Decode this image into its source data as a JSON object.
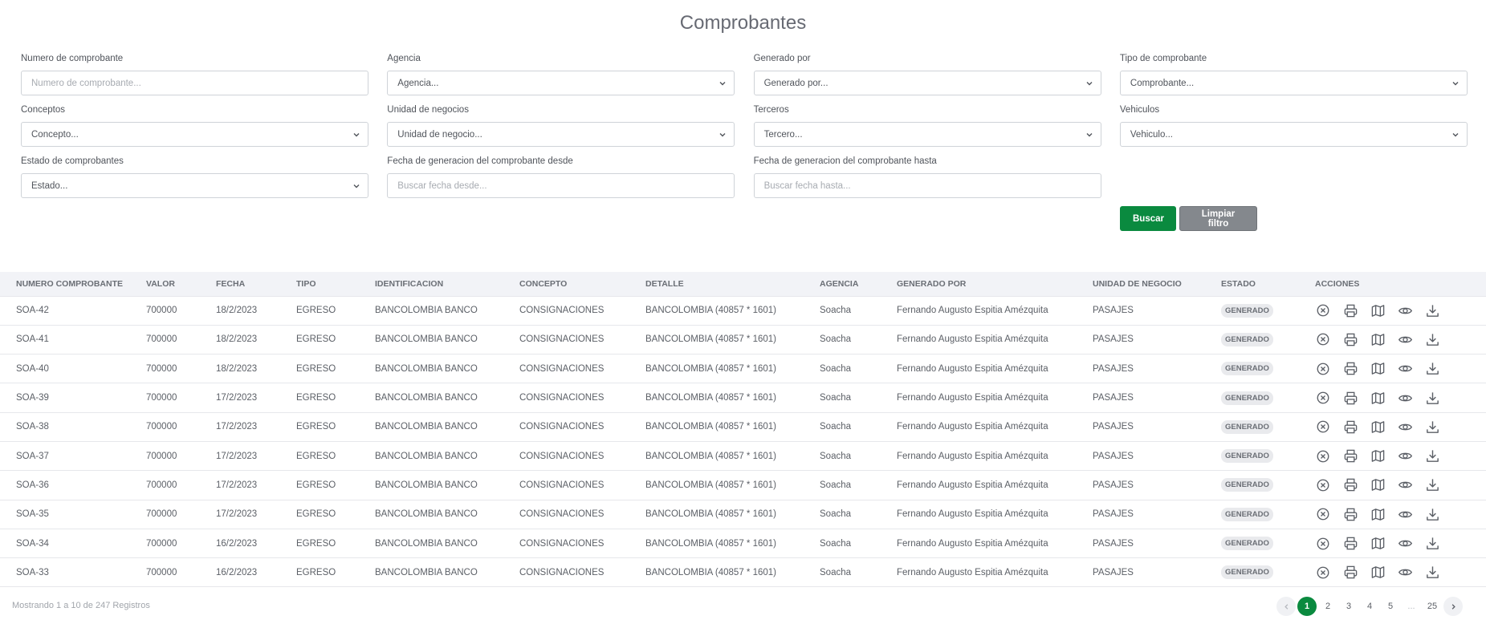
{
  "page": {
    "title": "Comprobantes"
  },
  "filters": [
    {
      "label": "Numero de comprobante",
      "kind": "input",
      "placeholder": "Numero de comprobante..."
    },
    {
      "label": "Agencia",
      "kind": "select",
      "value": "Agencia..."
    },
    {
      "label": "Generado por",
      "kind": "select",
      "value": "Generado por..."
    },
    {
      "label": "Tipo de comprobante",
      "kind": "select",
      "value": "Comprobante..."
    },
    {
      "label": "Conceptos",
      "kind": "select",
      "value": "Concepto..."
    },
    {
      "label": "Unidad de negocios",
      "kind": "select",
      "value": "Unidad de negocio..."
    },
    {
      "label": "Terceros",
      "kind": "select",
      "value": "Tercero..."
    },
    {
      "label": "Vehiculos",
      "kind": "select",
      "value": "Vehiculo..."
    },
    {
      "label": "Estado de comprobantes",
      "kind": "select",
      "value": "Estado..."
    },
    {
      "label": "Fecha de generacion del comprobante desde",
      "kind": "input",
      "placeholder": "Buscar fecha desde..."
    },
    {
      "label": "Fecha de generacion del comprobante hasta",
      "kind": "input",
      "placeholder": "Buscar fecha hasta..."
    }
  ],
  "buttons": {
    "search": "Buscar",
    "clear": "Limpiar filtro"
  },
  "table": {
    "headers": [
      "NUMERO COMPROBANTE",
      "VALOR",
      "FECHA",
      "TIPO",
      "IDENTIFICACION",
      "CONCEPTO",
      "DETALLE",
      "AGENCIA",
      "GENERADO POR",
      "UNIDAD DE NEGOCIO",
      "ESTADO",
      "ACCIONES"
    ],
    "rows": [
      [
        "SOA-42",
        "700000",
        "18/2/2023",
        "EGRESO",
        "BANCOLOMBIA BANCO",
        "CONSIGNACIONES",
        "BANCOLOMBIA (40857 * 1601)",
        "Soacha",
        "Fernando Augusto Espitia Amézquita",
        "PASAJES",
        "GENERADO"
      ],
      [
        "SOA-41",
        "700000",
        "18/2/2023",
        "EGRESO",
        "BANCOLOMBIA BANCO",
        "CONSIGNACIONES",
        "BANCOLOMBIA (40857 * 1601)",
        "Soacha",
        "Fernando Augusto Espitia Amézquita",
        "PASAJES",
        "GENERADO"
      ],
      [
        "SOA-40",
        "700000",
        "18/2/2023",
        "EGRESO",
        "BANCOLOMBIA BANCO",
        "CONSIGNACIONES",
        "BANCOLOMBIA (40857 * 1601)",
        "Soacha",
        "Fernando Augusto Espitia Amézquita",
        "PASAJES",
        "GENERADO"
      ],
      [
        "SOA-39",
        "700000",
        "17/2/2023",
        "EGRESO",
        "BANCOLOMBIA BANCO",
        "CONSIGNACIONES",
        "BANCOLOMBIA (40857 * 1601)",
        "Soacha",
        "Fernando Augusto Espitia Amézquita",
        "PASAJES",
        "GENERADO"
      ],
      [
        "SOA-38",
        "700000",
        "17/2/2023",
        "EGRESO",
        "BANCOLOMBIA BANCO",
        "CONSIGNACIONES",
        "BANCOLOMBIA (40857 * 1601)",
        "Soacha",
        "Fernando Augusto Espitia Amézquita",
        "PASAJES",
        "GENERADO"
      ],
      [
        "SOA-37",
        "700000",
        "17/2/2023",
        "EGRESO",
        "BANCOLOMBIA BANCO",
        "CONSIGNACIONES",
        "BANCOLOMBIA (40857 * 1601)",
        "Soacha",
        "Fernando Augusto Espitia Amézquita",
        "PASAJES",
        "GENERADO"
      ],
      [
        "SOA-36",
        "700000",
        "17/2/2023",
        "EGRESO",
        "BANCOLOMBIA BANCO",
        "CONSIGNACIONES",
        "BANCOLOMBIA (40857 * 1601)",
        "Soacha",
        "Fernando Augusto Espitia Amézquita",
        "PASAJES",
        "GENERADO"
      ],
      [
        "SOA-35",
        "700000",
        "17/2/2023",
        "EGRESO",
        "BANCOLOMBIA BANCO",
        "CONSIGNACIONES",
        "BANCOLOMBIA (40857 * 1601)",
        "Soacha",
        "Fernando Augusto Espitia Amézquita",
        "PASAJES",
        "GENERADO"
      ],
      [
        "SOA-34",
        "700000",
        "16/2/2023",
        "EGRESO",
        "BANCOLOMBIA BANCO",
        "CONSIGNACIONES",
        "BANCOLOMBIA (40857 * 1601)",
        "Soacha",
        "Fernando Augusto Espitia Amézquita",
        "PASAJES",
        "GENERADO"
      ],
      [
        "SOA-33",
        "700000",
        "16/2/2023",
        "EGRESO",
        "BANCOLOMBIA BANCO",
        "CONSIGNACIONES",
        "BANCOLOMBIA (40857 * 1601)",
        "Soacha",
        "Fernando Augusto Espitia Amézquita",
        "PASAJES",
        "GENERADO"
      ]
    ],
    "row_actions": [
      "cancel-icon",
      "print-icon",
      "map-icon",
      "view-icon",
      "download-icon"
    ]
  },
  "footer": {
    "summary": "Mostrando 1 a 10 de 247 Registros"
  },
  "pagination": {
    "pages": [
      "1",
      "2",
      "3",
      "4",
      "5",
      "...",
      "25"
    ],
    "current": "1"
  },
  "colors": {
    "primary": "#0a8a3f",
    "secondary": "#84888d",
    "header_bg": "#f2f3f7"
  }
}
